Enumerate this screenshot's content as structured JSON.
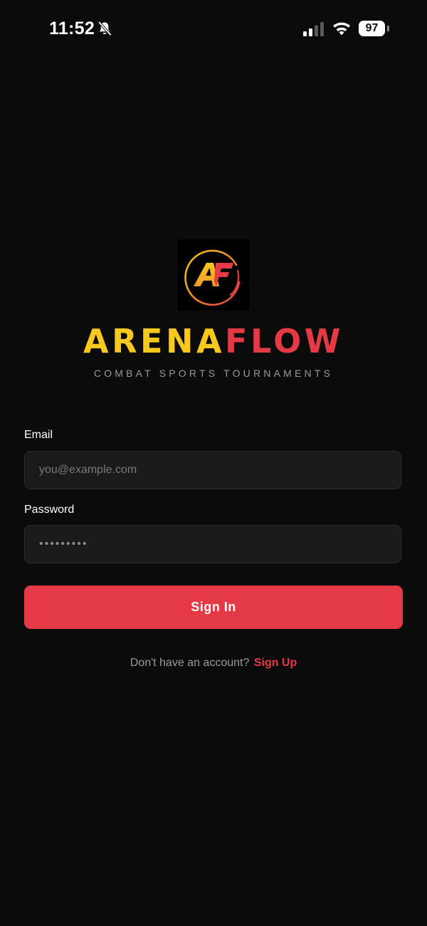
{
  "status_bar": {
    "time": "11:52",
    "battery_level": "97",
    "icons": [
      "bell-slash-icon",
      "cellular-signal-icon",
      "wifi-icon",
      "battery-icon"
    ]
  },
  "brand": {
    "logo_icon": "arenaflow-logo",
    "logo_letters": "AF",
    "name_part1": "ARENA",
    "name_part2": "FLOW",
    "tagline": "COMBAT SPORTS TOURNAMENTS"
  },
  "form": {
    "email_label": "Email",
    "email_placeholder": "you@example.com",
    "email_value": "",
    "password_label": "Password",
    "password_mask": "•••••••••",
    "submit_label": "Sign In"
  },
  "signup": {
    "prompt": "Don't have an account?",
    "link": "Sign Up"
  },
  "colors": {
    "background": "#0b0b0b",
    "accent_red": "#e63946",
    "accent_yellow": "#f8c81c",
    "field_bg": "#1a1a1a",
    "muted_text": "#9a9a9a"
  }
}
